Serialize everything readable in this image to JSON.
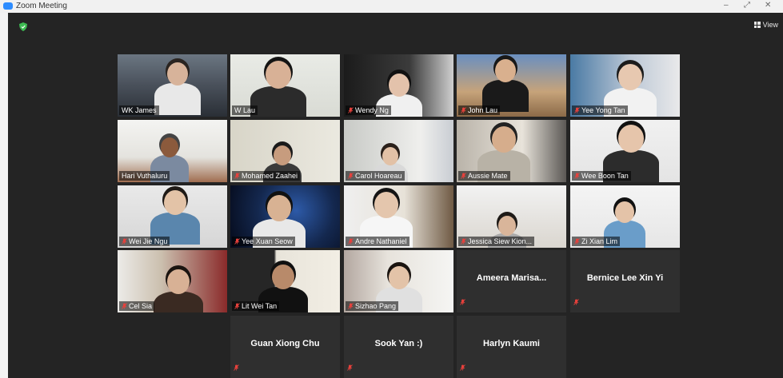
{
  "window": {
    "title": "Zoom Meeting"
  },
  "view_button": {
    "label": "View"
  },
  "colors": {
    "stage": "#242424",
    "active_border": "#b5e24a",
    "muted_icon": "#e8413c"
  },
  "participants": [
    {
      "name": "WK James",
      "muted": false
    },
    {
      "name": "W Lau",
      "muted": false
    },
    {
      "name": "Wendy Ng",
      "muted": true
    },
    {
      "name": "John Lau",
      "muted": true
    },
    {
      "name": "Yee Yong Tan",
      "muted": true
    },
    {
      "name": "Hari Vuthaluru",
      "muted": false
    },
    {
      "name": "Mohamed Zaahei",
      "muted": true
    },
    {
      "name": "Carol Hoareau",
      "muted": true
    },
    {
      "name": "Aussie Mate",
      "muted": true
    },
    {
      "name": "Wee Boon Tan",
      "muted": true
    },
    {
      "name": "Wei Jie Ngu",
      "muted": true
    },
    {
      "name": "Yee Xuan Seow",
      "muted": true
    },
    {
      "name": "Andre Nathaniel",
      "muted": true
    },
    {
      "name": "Jessica Siew Kion...",
      "muted": true
    },
    {
      "name": "Zi Xian Lim",
      "muted": true
    },
    {
      "name": "Cel Sia",
      "muted": true
    },
    {
      "name": "Lit Wei Tan",
      "muted": true
    },
    {
      "name": "Sizhao Pang",
      "muted": true
    },
    {
      "name": "Ameera Marisa...",
      "muted": true
    },
    {
      "name": "Bernice Lee Xin Yi",
      "muted": true
    },
    {
      "name": "Guan Xiong Chu",
      "muted": true
    },
    {
      "name": "Sook Yan :)",
      "muted": true
    },
    {
      "name": "Harlyn Kaumi",
      "muted": true
    }
  ]
}
